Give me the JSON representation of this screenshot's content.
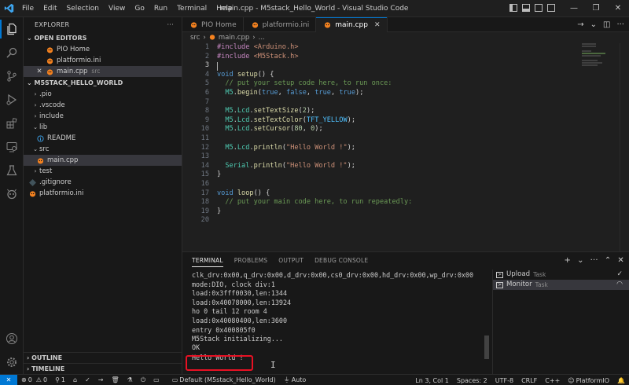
{
  "titlebar": {
    "menu": [
      "File",
      "Edit",
      "Selection",
      "View",
      "Go",
      "Run",
      "Terminal",
      "Help"
    ],
    "title": "main.cpp - M5stack_Hello_World - Visual Studio Code",
    "controls": [
      "minimize-icon",
      "restore-icon",
      "close-icon"
    ]
  },
  "activity_bar": [
    "files-icon",
    "search-icon",
    "source-control-icon",
    "run-debug-icon",
    "extensions-icon",
    "remote-explorer-icon",
    "testing-icon",
    "platformio-icon",
    "account-icon",
    "settings-gear-icon"
  ],
  "sidebar": {
    "title": "EXPLORER",
    "more": "···",
    "open_editors": {
      "header": "OPEN EDITORS",
      "items": [
        {
          "label": "PIO Home",
          "desc": ""
        },
        {
          "label": "platformio.ini",
          "desc": ""
        },
        {
          "label": "main.cpp",
          "desc": "src"
        }
      ]
    },
    "project": {
      "header": "M5STACK_HELLO_WORLD",
      "items": [
        {
          "label": ".pio",
          "kind": "folder-collapsed"
        },
        {
          "label": ".vscode",
          "kind": "folder-collapsed"
        },
        {
          "label": "include",
          "kind": "folder-collapsed"
        },
        {
          "label": "lib",
          "kind": "folder-expanded"
        },
        {
          "label": "README",
          "kind": "info-file"
        },
        {
          "label": "src",
          "kind": "folder-expanded"
        },
        {
          "label": "main.cpp",
          "kind": "cpp-file"
        },
        {
          "label": "test",
          "kind": "folder-collapsed"
        },
        {
          "label": ".gitignore",
          "kind": "git-file"
        },
        {
          "label": "platformio.ini",
          "kind": "platformio-file"
        }
      ]
    },
    "outline": "OUTLINE",
    "timeline": "TIMELINE"
  },
  "tabs": [
    {
      "label": "PIO Home",
      "active": false
    },
    {
      "label": "platformio.ini",
      "active": false
    },
    {
      "label": "main.cpp",
      "active": true
    }
  ],
  "breadcrumb": [
    "src",
    "main.cpp",
    "..."
  ],
  "editor": {
    "line_numbers": [
      "1",
      "2",
      "3",
      "4",
      "5",
      "6",
      "7",
      "8",
      "9",
      "10",
      "11",
      "12",
      "13",
      "14",
      "15",
      "16",
      "17",
      "18",
      "19",
      "20"
    ],
    "current_line": "3",
    "lines": [
      [
        {
          "t": "#include ",
          "c": "pre"
        },
        {
          "t": "<Arduino.h>",
          "c": "inc"
        }
      ],
      [
        {
          "t": "#include ",
          "c": "pre"
        },
        {
          "t": "<M5Stack.h>",
          "c": "inc"
        }
      ],
      [],
      [
        {
          "t": "void ",
          "c": "kw"
        },
        {
          "t": "setup",
          "c": "fn"
        },
        {
          "t": "() {",
          "c": "pl"
        }
      ],
      [
        {
          "t": "  // put your setup code here, to run once:",
          "c": "cm"
        }
      ],
      [
        {
          "t": "  M5",
          "c": "id"
        },
        {
          "t": ".",
          "c": "pl"
        },
        {
          "t": "begin",
          "c": "fn"
        },
        {
          "t": "(",
          "c": "pl"
        },
        {
          "t": "true",
          "c": "lit"
        },
        {
          "t": ", ",
          "c": "pl"
        },
        {
          "t": "false",
          "c": "lit"
        },
        {
          "t": ", ",
          "c": "pl"
        },
        {
          "t": "true",
          "c": "lit"
        },
        {
          "t": ", ",
          "c": "pl"
        },
        {
          "t": "true",
          "c": "lit"
        },
        {
          "t": ");",
          "c": "pl"
        }
      ],
      [],
      [
        {
          "t": "  M5",
          "c": "id"
        },
        {
          "t": ".",
          "c": "pl"
        },
        {
          "t": "Lcd",
          "c": "id"
        },
        {
          "t": ".",
          "c": "pl"
        },
        {
          "t": "setTextSize",
          "c": "fn"
        },
        {
          "t": "(",
          "c": "pl"
        },
        {
          "t": "2",
          "c": "num"
        },
        {
          "t": ");",
          "c": "pl"
        }
      ],
      [
        {
          "t": "  M5",
          "c": "id"
        },
        {
          "t": ".",
          "c": "pl"
        },
        {
          "t": "Lcd",
          "c": "id"
        },
        {
          "t": ".",
          "c": "pl"
        },
        {
          "t": "setTextColor",
          "c": "fn"
        },
        {
          "t": "(",
          "c": "pl"
        },
        {
          "t": "TFT_YELLOW",
          "c": "con"
        },
        {
          "t": ");",
          "c": "pl"
        }
      ],
      [
        {
          "t": "  M5",
          "c": "id"
        },
        {
          "t": ".",
          "c": "pl"
        },
        {
          "t": "Lcd",
          "c": "id"
        },
        {
          "t": ".",
          "c": "pl"
        },
        {
          "t": "setCursor",
          "c": "fn"
        },
        {
          "t": "(",
          "c": "pl"
        },
        {
          "t": "80",
          "c": "num"
        },
        {
          "t": ", ",
          "c": "pl"
        },
        {
          "t": "0",
          "c": "num"
        },
        {
          "t": ");",
          "c": "pl"
        }
      ],
      [],
      [
        {
          "t": "  M5",
          "c": "id"
        },
        {
          "t": ".",
          "c": "pl"
        },
        {
          "t": "Lcd",
          "c": "id"
        },
        {
          "t": ".",
          "c": "pl"
        },
        {
          "t": "println",
          "c": "fn"
        },
        {
          "t": "(",
          "c": "pl"
        },
        {
          "t": "\"Hello World !\"",
          "c": "str"
        },
        {
          "t": ");",
          "c": "pl"
        }
      ],
      [],
      [
        {
          "t": "  Serial",
          "c": "id"
        },
        {
          "t": ".",
          "c": "pl"
        },
        {
          "t": "println",
          "c": "fn"
        },
        {
          "t": "(",
          "c": "pl"
        },
        {
          "t": "\"Hello World !\"",
          "c": "str"
        },
        {
          "t": ");",
          "c": "pl"
        }
      ],
      [
        {
          "t": "}",
          "c": "pl"
        }
      ],
      [],
      [
        {
          "t": "void ",
          "c": "kw"
        },
        {
          "t": "loop",
          "c": "fn"
        },
        {
          "t": "() {",
          "c": "pl"
        }
      ],
      [
        {
          "t": "  // put your main code here, to run repeatedly:",
          "c": "cm"
        }
      ],
      [
        {
          "t": "}",
          "c": "pl"
        }
      ],
      []
    ]
  },
  "panel": {
    "tabs": [
      "TERMINAL",
      "PROBLEMS",
      "OUTPUT",
      "DEBUG CONSOLE"
    ],
    "active_tab": "TERMINAL",
    "actions": [
      "+",
      "⌄",
      "···",
      "⌃",
      "✕"
    ],
    "terminal_lines": [
      "clk_drv:0x00,q_drv:0x00,d_drv:0x00,cs0_drv:0x00,hd_drv:0x00,wp_drv:0x00",
      "mode:DIO, clock div:1",
      "load:0x3fff0030,len:1344",
      "load:0x40078000,len:13924",
      "ho 0 tail 12 room 4",
      "load:0x40080400,len:3600",
      "entry 0x400805f0",
      "M5Stack initializing...",
      "OK",
      "Hello World !"
    ],
    "tasks": [
      {
        "name": "Upload",
        "sub": "Task",
        "status": "✓"
      },
      {
        "name": "Monitor",
        "sub": "Task",
        "status": "◠"
      }
    ]
  },
  "statusbar": {
    "remote": "✕",
    "errors": "0",
    "warnings": "0",
    "ports": "1",
    "env": "Default (M5stack_Hello_World)",
    "port": "Auto",
    "position": "Ln 3, Col 1",
    "spaces": "Spaces: 2",
    "encoding": "UTF-8",
    "eol": "CRLF",
    "language": "C++",
    "platform": "PlatformIO"
  },
  "colors": {
    "accent": "#0078d4",
    "highlight_box": "#e81123",
    "platformio_orange": "#f5821f"
  }
}
